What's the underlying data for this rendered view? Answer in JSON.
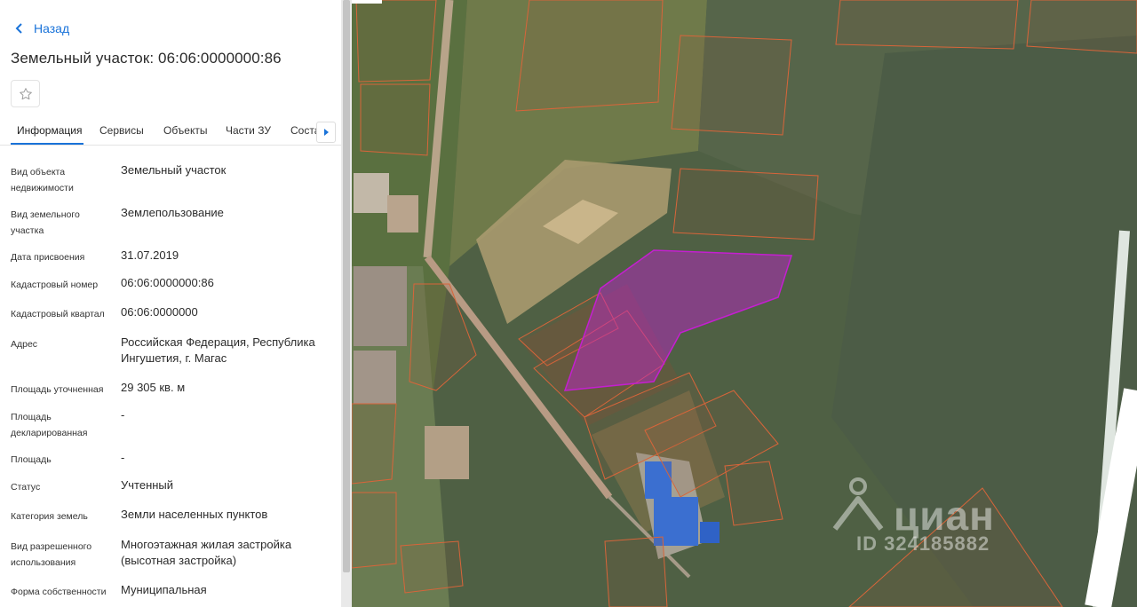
{
  "back": {
    "label": "Назад"
  },
  "page": {
    "title": "Земельный участок: 06:06:0000000:86"
  },
  "tabs": [
    {
      "label": "Информация",
      "active": true
    },
    {
      "label": "Сервисы",
      "active": false
    },
    {
      "label": "Объекты",
      "active": false
    },
    {
      "label": "Части ЗУ",
      "active": false
    },
    {
      "label": "Состав",
      "active": false
    }
  ],
  "properties": [
    {
      "label": "Вид объекта недвижимости",
      "value": "Земельный участок"
    },
    {
      "label": "Вид земельного участка",
      "value": "Землепользование"
    },
    {
      "label": "Дата присвоения",
      "value": "31.07.2019"
    },
    {
      "label": "Кадастровый номер",
      "value": "06:06:0000000:86"
    },
    {
      "label": "Кадастровый квартал",
      "value": "06:06:0000000"
    },
    {
      "label": "Адрес",
      "value": "Российская Федерация, Республика Ингушетия, г. Магас"
    },
    {
      "label": "Площадь уточненная",
      "value": "29 305 кв. м"
    },
    {
      "label": "Площадь декларированная",
      "value": "-"
    },
    {
      "label": "Площадь",
      "value": "-"
    },
    {
      "label": "Статус",
      "value": "Учтенный"
    },
    {
      "label": "Категория земель",
      "value": "Земли населенных пунктов"
    },
    {
      "label": "Вид разрешенного использования",
      "value": "Многоэтажная жилая застройка (высотная застройка)"
    },
    {
      "label": "Форма собственности",
      "value": "Муниципальная"
    }
  ],
  "map": {
    "watermark_brand": "циан",
    "watermark_id": "ID 324185882"
  },
  "colors": {
    "accent": "#1a73d9",
    "parcel_border": "#d8653a",
    "selected_parcel": "#c41fd0"
  },
  "icons": {
    "back": "chevron-left-icon",
    "favorite": "star-outline-icon",
    "tabs_next": "triangle-right-icon",
    "watermark": "location-pin-icon"
  }
}
